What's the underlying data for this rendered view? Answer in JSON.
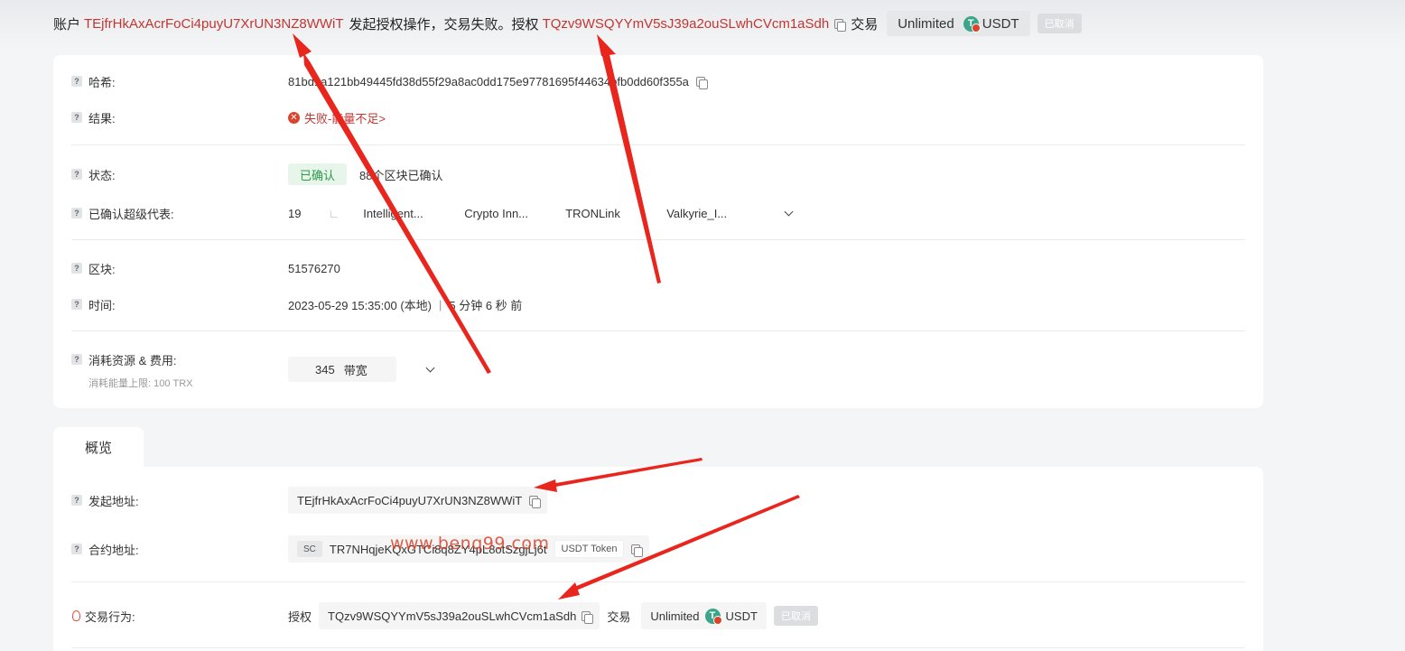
{
  "header": {
    "prefix": "账户",
    "account": "TEjfrHkAxAcrFoCi4puyU7XrUN3NZ8WWiT",
    "middle": "发起授权操作，交易失败。授权",
    "spender": "TQzv9WSQYYmV5sJ39a2ouSLwhCVcm1aSdh",
    "trade_label": "交易",
    "amount": "Unlimited",
    "token": "USDT",
    "status_tag": "已取消"
  },
  "details": {
    "hash": {
      "label": "哈希:",
      "value": "81bd1a121bb49445fd38d55f29a8ac0dd175e97781695f44634bfb0dd60f355a"
    },
    "result": {
      "label": "结果:",
      "value": "失败-能量不足>"
    },
    "status": {
      "label": "状态:",
      "badge": "已确认",
      "text": "88个区块已确认"
    },
    "super_reps": {
      "label": "已确认超级代表:",
      "count": "19",
      "separator": "∟",
      "items": [
        "Intelligent...",
        "Crypto Inn...",
        "TRONLink",
        "Valkyrie_I..."
      ]
    },
    "block": {
      "label": "区块:",
      "value": "51576270"
    },
    "time": {
      "label": "时间:",
      "value": "2023-05-29 15:35:00 (本地)",
      "separator": "|",
      "relative": "5 分钟 6 秒 前"
    },
    "resources": {
      "label": "消耗资源 & 费用:",
      "sublabel": "消耗能量上限: 100 TRX",
      "bandwidth_value": "345",
      "bandwidth_unit": "带宽"
    }
  },
  "overview": {
    "tab_label": "概览",
    "from": {
      "label": "发起地址:",
      "value": "TEjfrHkAxAcrFoCi4puyU7XrUN3NZ8WWiT"
    },
    "contract": {
      "label": "合约地址:",
      "badge": "SC",
      "value": "TR7NHqjeKQxGTCi8q8ZY4pL8otSzgjLj6t",
      "token_tag": "USDT Token"
    },
    "action": {
      "label": "交易行为:",
      "approve_label": "授权",
      "spender": "TQzv9WSQYYmV5sJ39a2ouSLwhCVcm1aSdh",
      "trade_label": "交易",
      "amount": "Unlimited",
      "token": "USDT",
      "status_tag": "已取消"
    }
  },
  "watermark": "www.benq99.com",
  "colors": {
    "accent_red": "#c23631",
    "confirm_green": "#2d9a4a",
    "usdt_green": "#3aa58a",
    "arrow_red": "#e8261d"
  }
}
